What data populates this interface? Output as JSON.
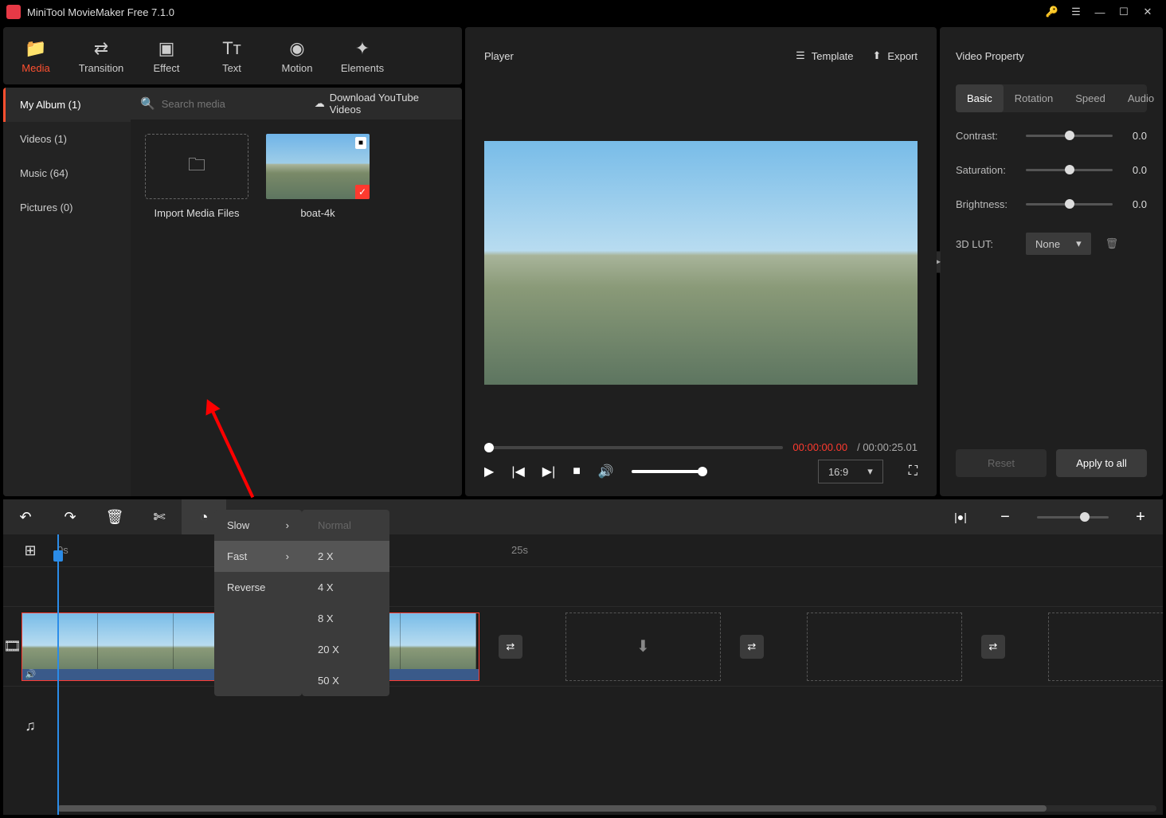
{
  "app": {
    "title": "MiniTool MovieMaker Free 7.1.0"
  },
  "mainTabs": [
    {
      "label": "Media",
      "icon": "📁"
    },
    {
      "label": "Transition",
      "icon": "⇄"
    },
    {
      "label": "Effect",
      "icon": "▣"
    },
    {
      "label": "Text",
      "icon": "Tᴛ"
    },
    {
      "label": "Motion",
      "icon": "◉"
    },
    {
      "label": "Elements",
      "icon": "✦"
    }
  ],
  "sidebar": {
    "items": [
      {
        "label": "My Album (1)"
      },
      {
        "label": "Videos (1)"
      },
      {
        "label": "Music (64)"
      },
      {
        "label": "Pictures (0)"
      }
    ]
  },
  "mediaHead": {
    "searchPlaceholder": "Search media",
    "ytLabel": "Download YouTube Videos"
  },
  "mediaGrid": {
    "importLabel": "Import Media Files",
    "clipName": "boat-4k"
  },
  "player": {
    "title": "Player",
    "templateLabel": "Template",
    "exportLabel": "Export",
    "currentTime": "00:00:00.00",
    "totalTime": "/ 00:00:25.01",
    "aspect": "16:9"
  },
  "props": {
    "title": "Video Property",
    "tabs": [
      "Basic",
      "Rotation",
      "Speed",
      "Audio"
    ],
    "contrast": {
      "label": "Contrast:",
      "value": "0.0"
    },
    "saturation": {
      "label": "Saturation:",
      "value": "0.0"
    },
    "brightness": {
      "label": "Brightness:",
      "value": "0.0"
    },
    "lut": {
      "label": "3D LUT:",
      "value": "None"
    },
    "reset": "Reset",
    "apply": "Apply to all"
  },
  "timeline": {
    "mark0": "0s",
    "mark25": "25s"
  },
  "speedMenu": {
    "slow": "Slow",
    "fast": "Fast",
    "reverse": "Reverse",
    "options": [
      "Normal",
      "2 X",
      "4 X",
      "8 X",
      "20 X",
      "50 X"
    ]
  }
}
